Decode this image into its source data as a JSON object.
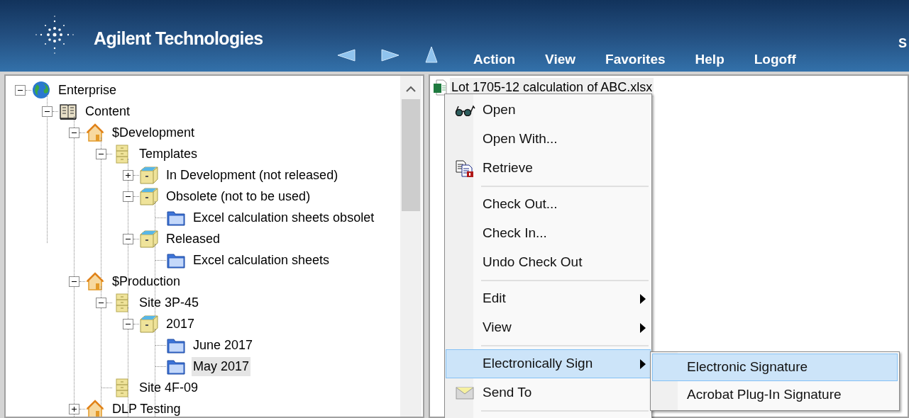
{
  "header": {
    "brand": "Agilent Technologies",
    "menu": [
      "Action",
      "View",
      "Favorites",
      "Help",
      "Logoff"
    ],
    "edge_text": "S"
  },
  "tree": [
    {
      "label": "Enterprise",
      "kind": "globe",
      "expanded": true,
      "selected": false,
      "children": [
        {
          "label": "Content",
          "kind": "book",
          "expanded": true,
          "selected": false,
          "children": [
            {
              "label": "$Development",
              "kind": "house",
              "expanded": true,
              "selected": false,
              "children": [
                {
                  "label": "Templates",
                  "kind": "cabinet",
                  "expanded": true,
                  "selected": false,
                  "children": [
                    {
                      "label": "In Development (not released)",
                      "kind": "drawer",
                      "expanded": false,
                      "selected": false
                    },
                    {
                      "label": "Obsolete (not to be used)",
                      "kind": "drawer",
                      "expanded": true,
                      "selected": false,
                      "children": [
                        {
                          "label": "Excel calculation sheets obsolet",
                          "kind": "folder",
                          "selected": false
                        }
                      ]
                    },
                    {
                      "label": "Released",
                      "kind": "drawer",
                      "expanded": true,
                      "selected": false,
                      "children": [
                        {
                          "label": "Excel calculation sheets",
                          "kind": "folder",
                          "selected": false
                        }
                      ]
                    }
                  ]
                }
              ]
            },
            {
              "label": "$Production",
              "kind": "house",
              "expanded": true,
              "selected": false,
              "children": [
                {
                  "label": "Site 3P-45",
                  "kind": "cabinet",
                  "expanded": true,
                  "selected": false,
                  "children": [
                    {
                      "label": "2017",
                      "kind": "drawer",
                      "expanded": true,
                      "selected": false,
                      "children": [
                        {
                          "label": "June 2017",
                          "kind": "folder",
                          "selected": false
                        },
                        {
                          "label": "May 2017",
                          "kind": "folder",
                          "selected": true
                        }
                      ]
                    }
                  ]
                },
                {
                  "label": "Site 4F-09",
                  "kind": "cabinet",
                  "selected": false
                }
              ]
            },
            {
              "label": "DLP Testing",
              "kind": "house",
              "expanded": false,
              "selected": false
            }
          ]
        }
      ]
    }
  ],
  "file": {
    "name": "Lot 1705-12 calculation of ABC.xlsx"
  },
  "context_menu": [
    [
      {
        "label": "Open",
        "kind": "glasses",
        "submenu": false,
        "selected": false
      },
      {
        "label": "Open With...",
        "submenu": false,
        "selected": false
      },
      {
        "label": "Retrieve",
        "kind": "retrieve",
        "submenu": false,
        "selected": false
      }
    ],
    [
      {
        "label": "Check Out...",
        "submenu": false,
        "selected": false
      },
      {
        "label": "Check In...",
        "submenu": false,
        "selected": false
      },
      {
        "label": "Undo Check Out",
        "submenu": false,
        "selected": false
      }
    ],
    [
      {
        "label": "Edit",
        "submenu": true,
        "selected": false
      },
      {
        "label": "View",
        "submenu": true,
        "selected": false
      }
    ],
    [
      {
        "label": "Electronically Sign",
        "submenu": true,
        "selected": true
      },
      {
        "label": "Send To",
        "kind": "envelope",
        "submenu": false,
        "selected": false
      }
    ]
  ],
  "submenu": [
    {
      "label": "Electronic Signature",
      "selected": true
    },
    {
      "label": "Acrobat Plug-In Signature",
      "selected": false
    }
  ]
}
